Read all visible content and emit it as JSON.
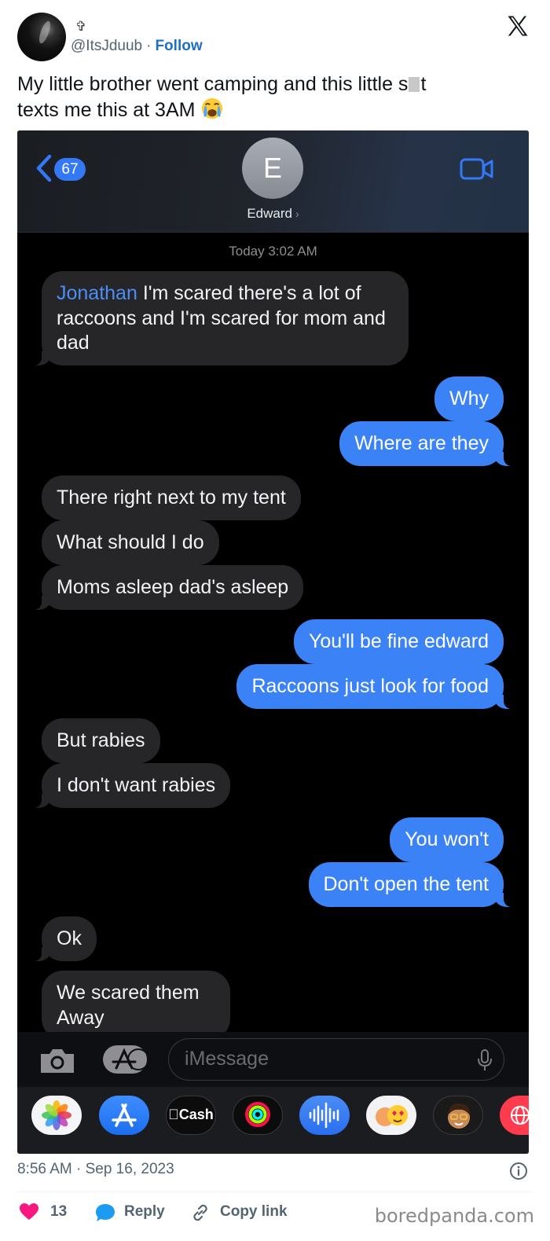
{
  "tweet": {
    "display_name": "✞",
    "handle": "@ItsJduub",
    "separator": "·",
    "follow_label": "Follow",
    "text_part1": "My little brother went camping and this little s",
    "text_part2": "t",
    "text_part3": "texts me this at 3AM",
    "emoji": "crying-face-emoji",
    "time": "8:56 AM · Sep 16, 2023",
    "likes": "13",
    "reply_label": "Reply",
    "copy_label": "Copy link",
    "watermark": "boredpanda.com"
  },
  "imessage": {
    "back_count": "67",
    "contact_initial": "E",
    "contact_name": "Edward",
    "chevron": "›",
    "timestamp": "Today 3:02 AM",
    "messages": [
      {
        "from": "them",
        "sender": "Jonathan",
        "text": " I'm scared there's a lot of raccoons and I'm scared for mom and dad"
      },
      {
        "from": "me",
        "text": "Why"
      },
      {
        "from": "me",
        "text": "Where are they"
      },
      {
        "from": "them",
        "text": "There right next to my tent"
      },
      {
        "from": "them",
        "text": "What should I do"
      },
      {
        "from": "them",
        "text": "Moms asleep dad's asleep"
      },
      {
        "from": "me",
        "text": "You'll be fine edward"
      },
      {
        "from": "me",
        "text": "Raccoons just look for food"
      },
      {
        "from": "them",
        "text": "But rabies"
      },
      {
        "from": "them",
        "text": "I don't want rabies"
      },
      {
        "from": "me",
        "text": "You won't"
      },
      {
        "from": "me",
        "text": "Don't open the tent"
      },
      {
        "from": "them",
        "text": "Ok"
      },
      {
        "from": "them",
        "text": "We scared them Away"
      }
    ],
    "compose_placeholder": "iMessage",
    "cash_label": "Cash",
    "apps": [
      "photos-app-icon",
      "app-store-icon",
      "apple-cash-icon",
      "activity-rings-icon",
      "audio-message-icon",
      "memoji-stickers-icon",
      "memoji-icon",
      "web-browser-icon"
    ]
  },
  "colors": {
    "follow": "#1d6fc8",
    "outgoing_bubble": "#3b82f6",
    "incoming_bubble": "#262629",
    "sender_name": "#4b8ef5",
    "like_heart": "#f91880",
    "reply_bubble": "#1d9bf0"
  }
}
